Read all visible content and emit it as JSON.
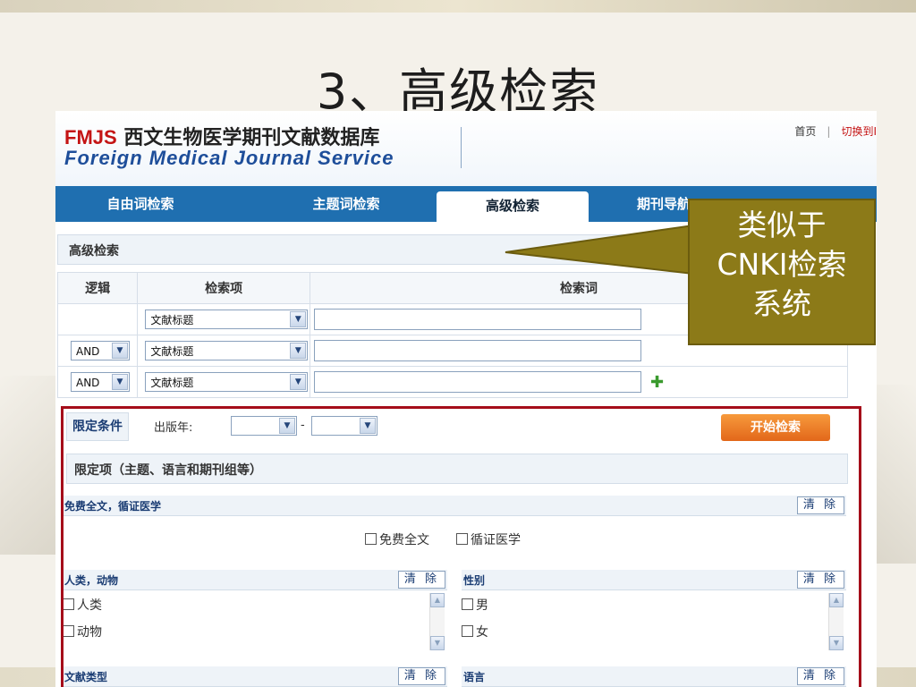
{
  "slide": {
    "title": "3、高级检索"
  },
  "header": {
    "logo_abbr": "FMJS",
    "logo_cn": "西文生物医学期刊文献数据库",
    "logo_en": "Foreign Medical Journal Service",
    "link_home": "首页",
    "link_sep": "|",
    "link_lang": "切换到I"
  },
  "nav": {
    "tabs": [
      "自由词检索",
      "主题词检索",
      "高级检索",
      "期刊导航"
    ],
    "active_index": 2
  },
  "search": {
    "section_title": "高级检索",
    "columns": [
      "逻辑",
      "检索项",
      "检索词"
    ],
    "rows": [
      {
        "logic": "",
        "field": "文献标题",
        "term": ""
      },
      {
        "logic": "AND",
        "field": "文献标题",
        "term": ""
      },
      {
        "logic": "AND",
        "field": "文献标题",
        "term": ""
      }
    ]
  },
  "filters": {
    "label": "限定条件",
    "year_label": "出版年:",
    "year_sep": "-",
    "start_button": "开始检索",
    "sub_title": "限定项（主题、语言和期刊组等）",
    "clear_label": "清 除",
    "group1": {
      "title": "免费全文，循证医学",
      "options": [
        "免费全文",
        "循证医学"
      ]
    },
    "group2": {
      "title": "人类，动物",
      "options": [
        "人类",
        "动物"
      ]
    },
    "group3": {
      "title": "性别",
      "options": [
        "男",
        "女"
      ]
    },
    "group4": {
      "title": "文献类型"
    },
    "group5": {
      "title": "语言"
    }
  },
  "callout": {
    "lines": [
      "类似于",
      "CNKI检索",
      "系统"
    ]
  },
  "colors": {
    "nav_blue": "#1f6fb0",
    "red_box": "#a50d1a",
    "callout": "#8c7a18",
    "button_orange": "#e2671a",
    "logo_red": "#c41414",
    "logo_blue": "#1e4e9a"
  }
}
